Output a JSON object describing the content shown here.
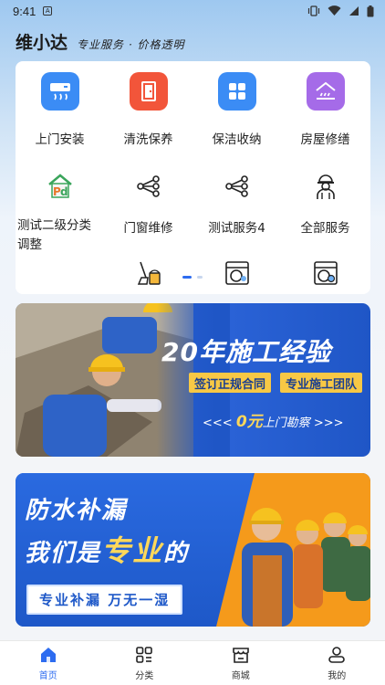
{
  "status_bar": {
    "time": "9:41",
    "sim_label": "A"
  },
  "header": {
    "title": "维小达",
    "slogan": "专业服务 · 价格透明"
  },
  "categories_row1": [
    {
      "label": "上门安装",
      "icon": "ac-install-icon",
      "color": "#3b8cf5"
    },
    {
      "label": "清洗保养",
      "icon": "door-clean-icon",
      "color": "#f2553a"
    },
    {
      "label": "保洁收纳",
      "icon": "grid-storage-icon",
      "color": "#3b8cf5"
    },
    {
      "label": "房屋修缮",
      "icon": "house-repair-icon",
      "color": "#a56be8"
    }
  ],
  "categories_row2": [
    {
      "label": "测试二级分类调整",
      "icon": "house-pd-icon"
    },
    {
      "label": "门窗维修",
      "icon": "share-nodes-icon"
    },
    {
      "label": "测试服务4",
      "icon": "share-nodes-icon"
    },
    {
      "label": "全部服务",
      "icon": "worker-avatar-icon"
    }
  ],
  "banner1": {
    "headline": "20年施工经验",
    "tag1": "签订正规合同",
    "tag2": "专业施工团队",
    "sub_prefix": "<<<",
    "sub_num": "0元",
    "sub_text": "上门勘察",
    "sub_suffix": ">>>"
  },
  "banner2": {
    "line1": "防水补漏",
    "line2_a": "我们是",
    "line2_b": "专业",
    "line2_c": "的",
    "pill": "专业补漏  万无一湿"
  },
  "tabs": [
    {
      "label": "首页",
      "icon": "home-icon",
      "active": true
    },
    {
      "label": "分类",
      "icon": "category-icon",
      "active": false
    },
    {
      "label": "商城",
      "icon": "store-icon",
      "active": false
    },
    {
      "label": "我的",
      "icon": "user-icon",
      "active": false
    }
  ]
}
